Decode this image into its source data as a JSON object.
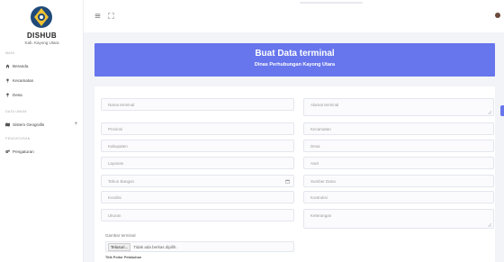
{
  "sidebar": {
    "brand": "DISHUB",
    "brand_sub": "Kab. Kayong Utara",
    "sections": [
      "MAIN",
      "DATA UMUM",
      "PENGATURAN"
    ],
    "items": [
      {
        "label": "Beranda",
        "icon": "home-icon"
      },
      {
        "label": "Kecamatan",
        "icon": "pin-icon"
      },
      {
        "label": "Desa",
        "icon": "pin-icon"
      },
      {
        "label": "Sistem Geografis",
        "icon": "map-icon"
      },
      {
        "label": "Pengaturan",
        "icon": "gears-icon"
      }
    ],
    "expand_symbol": "+"
  },
  "header": {
    "title": "Buat Data terminal",
    "subtitle": "Dinas Perhubungan Kayong Utara"
  },
  "form": {
    "nama_terminal": "Nama terminal",
    "alamat_terminal": "Alamat terminal",
    "provinsi": "Provinsi",
    "kecamatan": "Kecamatan",
    "kabupaten": "Kabupaten",
    "desa": "Desa",
    "layanan": "Layanan",
    "aset": "Aset",
    "tahun_bangun": "Tahun Bangun",
    "sumber_dana": "Sumber Dana",
    "kondisi": "Kondisi",
    "kontruksi": "Kontruksi",
    "ukuran": "Ukuran",
    "keterangan": "Keterangan",
    "gambar_label": "Gambar terminal",
    "file_button": "Telusuri...",
    "file_status": "Tidak ada berkas dipilih.",
    "koordinat_label": "Titik Poitor Pelabuhan"
  },
  "colors": {
    "accent": "#6776ec",
    "sidebar_bg": "#ffffff",
    "page_bg": "#f3f4f8"
  }
}
